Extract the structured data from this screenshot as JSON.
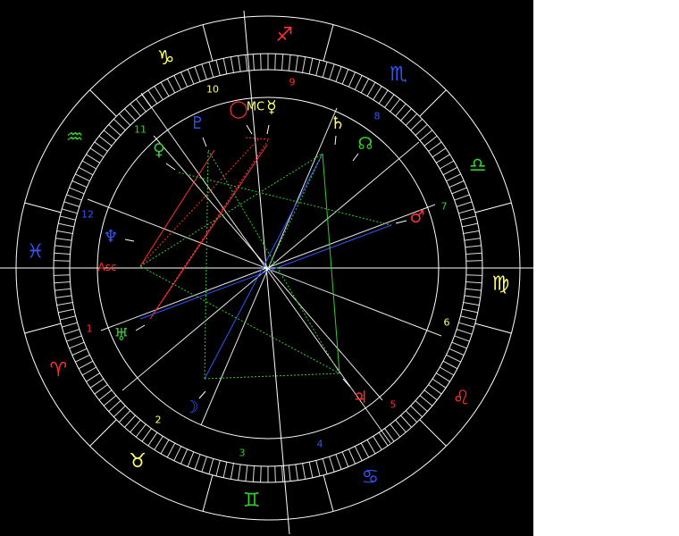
{
  "colors": {
    "background": "#000000",
    "page": "#ffffff",
    "wheel_lines": "#ffffff",
    "fire": "#ff3030",
    "earth": "#ffff66",
    "air": "#33cc33",
    "water": "#3355ff"
  },
  "signs": [
    {
      "name": "sagittarius",
      "glyph": "♐",
      "color": "#ff3030"
    },
    {
      "name": "scorpio",
      "glyph": "♏",
      "color": "#3355ff"
    },
    {
      "name": "libra",
      "glyph": "♎",
      "color": "#33cc33"
    },
    {
      "name": "virgo",
      "glyph": "♍",
      "color": "#ffff66"
    },
    {
      "name": "leo",
      "glyph": "♌",
      "color": "#ff3030"
    },
    {
      "name": "cancer",
      "glyph": "♋",
      "color": "#3355ff"
    },
    {
      "name": "gemini",
      "glyph": "♊",
      "color": "#33cc33"
    },
    {
      "name": "taurus",
      "glyph": "♉",
      "color": "#ffff66"
    },
    {
      "name": "aries",
      "glyph": "♈",
      "color": "#ff3030"
    },
    {
      "name": "pisces",
      "glyph": "♓",
      "color": "#3355ff"
    },
    {
      "name": "aquarius",
      "glyph": "♒",
      "color": "#33cc33"
    },
    {
      "name": "capricorn",
      "glyph": "♑",
      "color": "#ffff66"
    }
  ],
  "houses": [
    {
      "label": "1",
      "color": "#ff3030"
    },
    {
      "label": "2",
      "color": "#ffff66"
    },
    {
      "label": "3",
      "color": "#33cc33"
    },
    {
      "label": "4",
      "color": "#3355ff"
    },
    {
      "label": "5",
      "color": "#ff3030"
    },
    {
      "label": "6",
      "color": "#ffff66"
    },
    {
      "label": "7",
      "color": "#33cc33"
    },
    {
      "label": "8",
      "color": "#3355ff"
    },
    {
      "label": "9",
      "color": "#ff3030"
    },
    {
      "label": "10",
      "color": "#ffff66"
    },
    {
      "label": "11",
      "color": "#33cc33"
    },
    {
      "label": "12",
      "color": "#3355ff"
    }
  ],
  "angles": {
    "asc": {
      "label": "Asc",
      "color": "#ff3030"
    },
    "mc": {
      "label": "MC",
      "color": "#ffff66"
    }
  },
  "planets": [
    {
      "name": "sun",
      "glyph": "◯",
      "color": "#ff3030"
    },
    {
      "name": "mercury",
      "glyph": "☿",
      "color": "#ffff66"
    },
    {
      "name": "venus",
      "glyph": "♀",
      "color": "#33cc33"
    },
    {
      "name": "moon",
      "glyph": "☽",
      "color": "#3355ff"
    },
    {
      "name": "mars",
      "glyph": "♂",
      "color": "#ff3030"
    },
    {
      "name": "jupiter",
      "glyph": "♃",
      "color": "#ff3030"
    },
    {
      "name": "saturn",
      "glyph": "♄",
      "color": "#ffff66"
    },
    {
      "name": "uranus",
      "glyph": "♅",
      "color": "#33cc33"
    },
    {
      "name": "neptune",
      "glyph": "♆",
      "color": "#3355ff"
    },
    {
      "name": "pluto",
      "glyph": "♇",
      "color": "#3355ff"
    },
    {
      "name": "node",
      "glyph": "☊",
      "color": "#33cc33"
    }
  ]
}
